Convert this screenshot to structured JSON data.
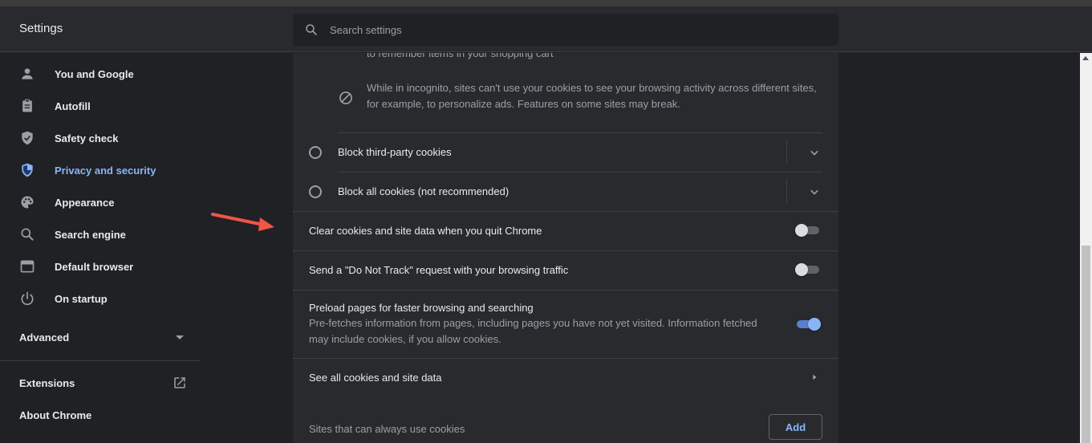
{
  "app": {
    "title": "Settings"
  },
  "search": {
    "placeholder": "Search settings"
  },
  "sidebar": {
    "items": [
      {
        "label": "You and Google",
        "icon": "person-icon"
      },
      {
        "label": "Autofill",
        "icon": "clipboard-icon"
      },
      {
        "label": "Safety check",
        "icon": "shield-check-icon"
      },
      {
        "label": "Privacy and security",
        "icon": "shield-icon",
        "active": true
      },
      {
        "label": "Appearance",
        "icon": "palette-icon"
      },
      {
        "label": "Search engine",
        "icon": "search-icon"
      },
      {
        "label": "Default browser",
        "icon": "browser-window-icon"
      },
      {
        "label": "On startup",
        "icon": "power-icon"
      }
    ],
    "advanced_label": "Advanced",
    "extensions_label": "Extensions",
    "about_label": "About Chrome"
  },
  "content": {
    "cut_off_text": "to remember items in your shopping cart",
    "incognito_note": "While in incognito, sites can't use your cookies to see your browsing activity across different sites, for example, to personalize ads. Features on some sites may break.",
    "block_third_party": "Block third-party cookies",
    "block_all": "Block all cookies (not recommended)",
    "clear_on_quit": "Clear cookies and site data when you quit Chrome",
    "clear_on_quit_enabled": false,
    "do_not_track": "Send a \"Do Not Track\" request with your browsing traffic",
    "do_not_track_enabled": false,
    "preload_title": "Preload pages for faster browsing and searching",
    "preload_desc": "Pre-fetches information from pages, including pages you have not yet visited. Information fetched may include cookies, if you allow cookies.",
    "preload_enabled": true,
    "see_all": "See all cookies and site data",
    "always_allow": "Sites that can always use cookies",
    "add_label": "Add"
  },
  "colors": {
    "accent": "#8ab4f8",
    "background": "#202124",
    "card": "#292a2d",
    "annotation_arrow": "#f05545"
  }
}
